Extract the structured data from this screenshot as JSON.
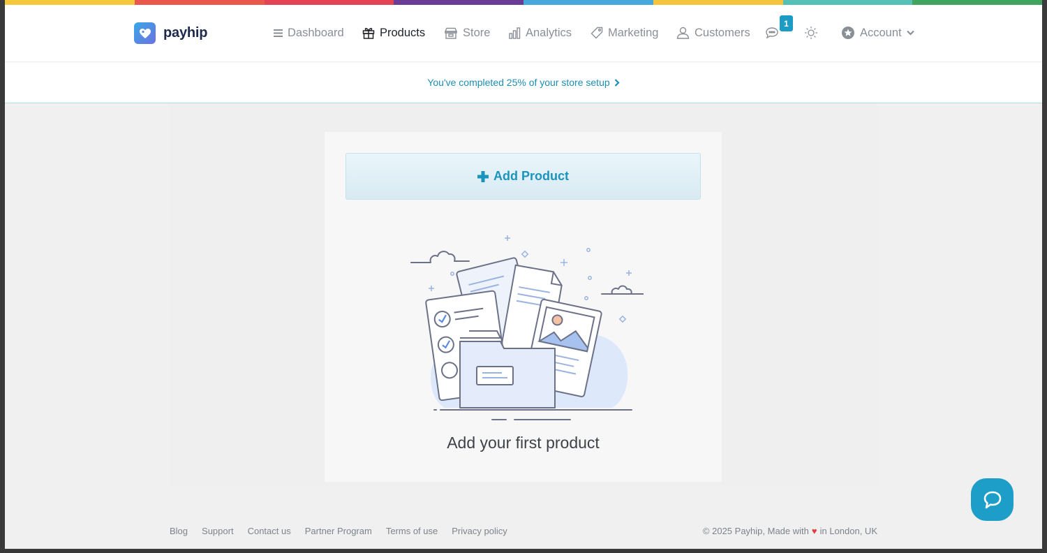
{
  "colors": {
    "accent": "#1c9bc4",
    "rainbow": [
      "#f5c73c",
      "#e9574d",
      "#e24454",
      "#6a3c96",
      "#45aadb",
      "#f4c43c",
      "#55c1b6",
      "#3fa45d"
    ]
  },
  "brand": {
    "name": "payhip",
    "logo_icon": "heart-tag-icon"
  },
  "nav": {
    "dashboard": {
      "label": "Dashboard",
      "icon": "menu-icon"
    },
    "products": {
      "label": "Products",
      "icon": "gift-icon"
    },
    "store": {
      "label": "Store",
      "icon": "store-icon"
    },
    "analytics": {
      "label": "Analytics",
      "icon": "bar-chart-icon"
    },
    "marketing": {
      "label": "Marketing",
      "icon": "tag-icon"
    },
    "customers": {
      "label": "Customers",
      "icon": "user-icon"
    },
    "messages": {
      "icon": "chat-icon",
      "badge": "1"
    },
    "theme": {
      "icon": "sun-icon"
    },
    "account": {
      "label": "Account",
      "icon": "star-badge-icon"
    }
  },
  "setup": {
    "text": "You've completed 25% of your store setup",
    "progress_percent": 25
  },
  "main": {
    "add_product_label": "Add Product",
    "empty_title": "Add your first product"
  },
  "footer": {
    "links": [
      "Blog",
      "Support",
      "Contact us",
      "Partner Program",
      "Terms of use",
      "Privacy policy"
    ],
    "copyright_prefix": "© 2025 Payhip, Made with",
    "heart": "♥",
    "copyright_suffix": "in London, UK"
  }
}
